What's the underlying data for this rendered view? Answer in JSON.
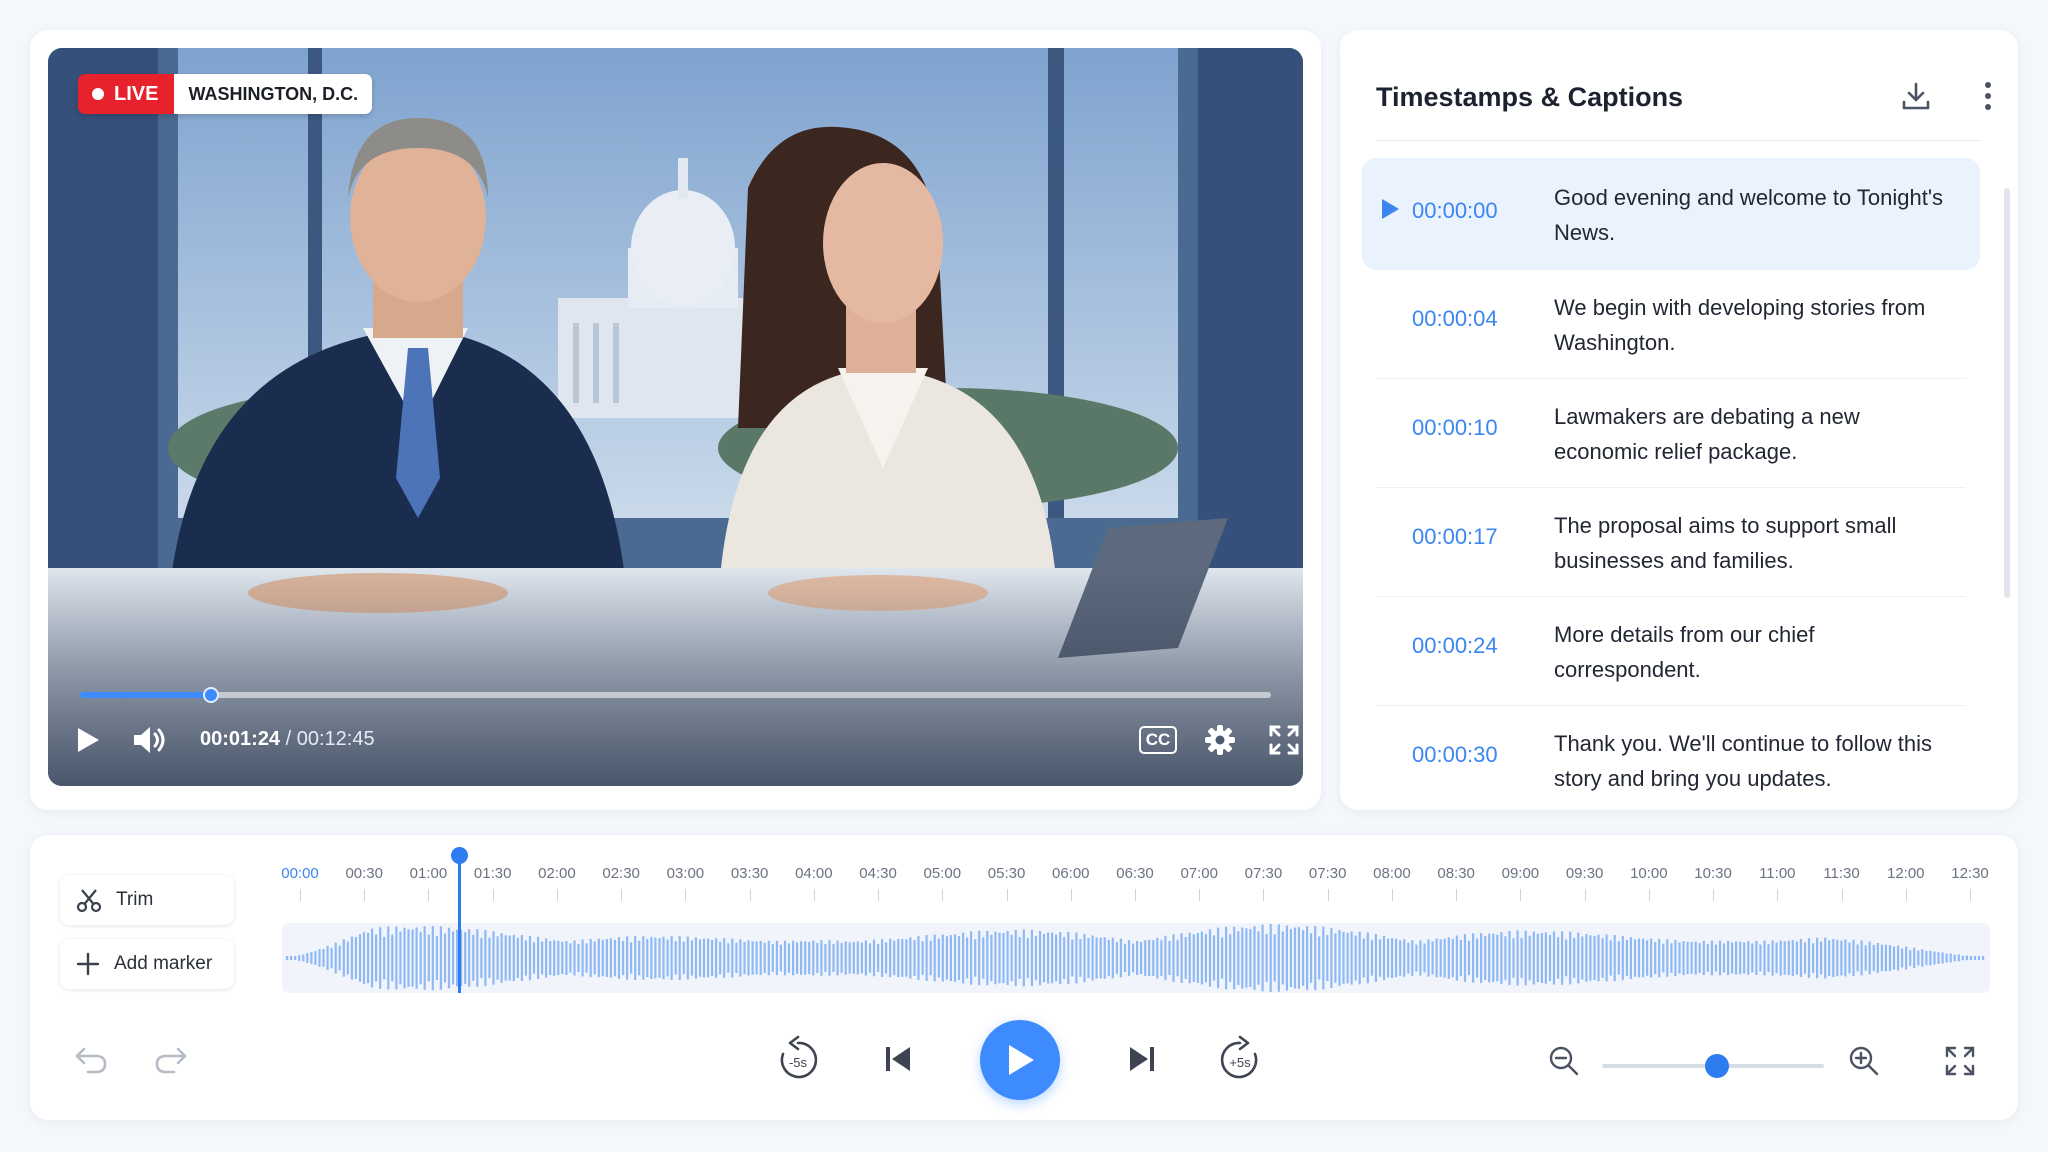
{
  "video": {
    "live_label": "LIVE",
    "location": "WASHINGTON, D.C.",
    "current_time": "00:01:24",
    "total_time": "/ 00:12:45",
    "progress_fraction": 0.11,
    "cc_label": "CC"
  },
  "captions": {
    "title": "Timestamps & Captions",
    "items": [
      {
        "time": "00:00:00",
        "text": "Good evening and welcome to Tonight's News.",
        "active": true
      },
      {
        "time": "00:00:04",
        "text": "We begin with developing stories from Washington.",
        "active": false
      },
      {
        "time": "00:00:10",
        "text": "Lawmakers are debating a new economic relief package.",
        "active": false
      },
      {
        "time": "00:00:17",
        "text": "The proposal aims to support small businesses and families.",
        "active": false
      },
      {
        "time": "00:00:24",
        "text": "More details from our chief correspondent.",
        "active": false
      },
      {
        "time": "00:00:30",
        "text": "Thank you. We'll continue to follow this story and bring you updates.",
        "active": false
      }
    ]
  },
  "timeline": {
    "trim_label": "Trim",
    "add_marker_label": "Add marker",
    "ticks": [
      "00:00",
      "00:30",
      "01:00",
      "01:30",
      "02:00",
      "02:30",
      "03:00",
      "03:30",
      "04:00",
      "04:30",
      "05:00",
      "05:30",
      "06:00",
      "06:30",
      "07:00",
      "07:30",
      "07:30",
      "08:00",
      "08:30",
      "09:00",
      "09:30",
      "10:00",
      "10:30",
      "11:00",
      "11:30",
      "12:00",
      "12:30"
    ],
    "rewind_label": "-5s",
    "forward_label": "+5s",
    "zoom_level_fraction": 0.52
  },
  "colors": {
    "accent": "#3d8bff",
    "live_red": "#e8222d",
    "timestamp_blue": "#3b86f0",
    "active_row": "#eaf2fe"
  }
}
